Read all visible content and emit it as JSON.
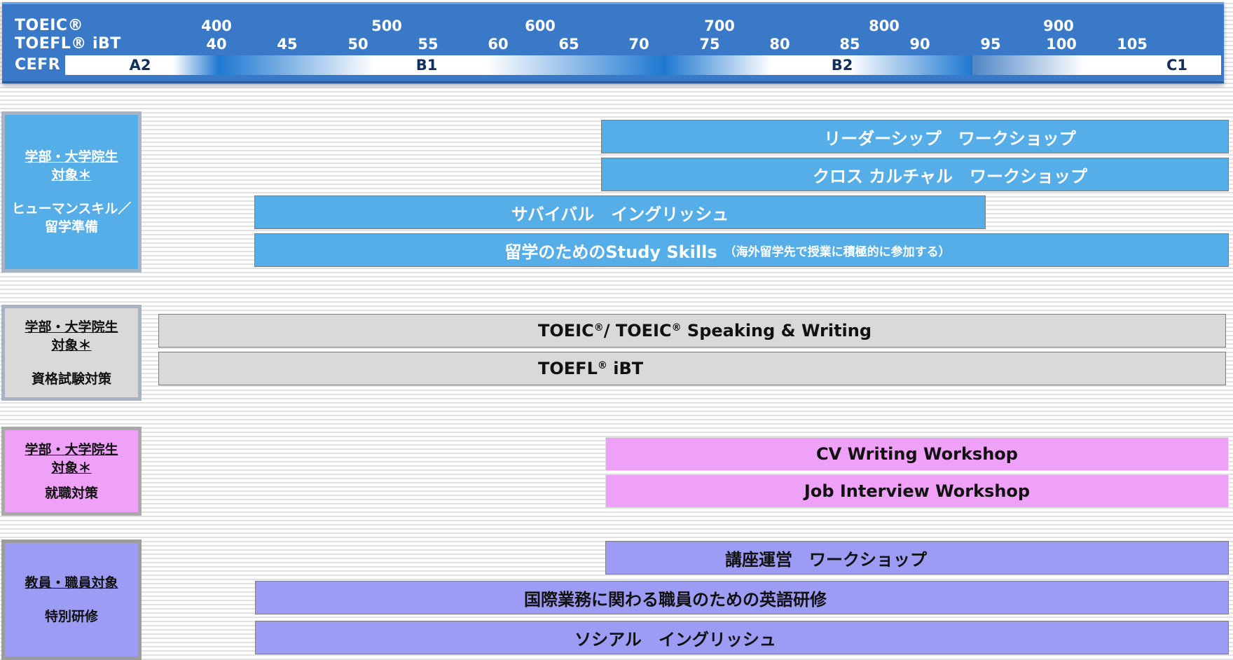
{
  "scales": {
    "toeic_label": "TOEIC®",
    "toeic_ticks": [
      "400",
      "500",
      "600",
      "700",
      "800",
      "900"
    ],
    "toefl_label": "TOEFL® iBT",
    "toefl_ticks": [
      "40",
      "45",
      "50",
      "55",
      "60",
      "65",
      "70",
      "75",
      "80",
      "85",
      "90",
      "95",
      "100",
      "105"
    ],
    "cefr_label": "CEFR",
    "cefr_levels": [
      "A2",
      "B1",
      "B2",
      "C1"
    ]
  },
  "categories": [
    {
      "audience_line1": "学部・大学院生",
      "audience_line2": "対象＊",
      "topic_line1": "ヒューマンスキル／",
      "topic_line2": "留学準備",
      "color": "#55aee8"
    },
    {
      "audience_line1": "学部・大学院生",
      "audience_line2": "対象＊",
      "topic_line1": "資格試験対策",
      "color": "#d9d9d9"
    },
    {
      "audience_line1": "学部・大学院生",
      "audience_line2": "対象＊",
      "topic_line1": "就職対策",
      "color": "#efa0f7"
    },
    {
      "audience_line1": "教員・職員対象",
      "topic_line1": "特別研修",
      "color": "#9c9cf4"
    }
  ],
  "programs": {
    "leadership": "リーダーシップ　ワークショップ",
    "cross_cultural": "クロス カルチャル　ワークショップ",
    "survival": "サバイバル　イングリッシュ",
    "study_skills": "留学のためのStudy Skills",
    "study_skills_note": "（海外留学先で授業に積極的に参加する）",
    "toeic_sw_pre": "TOEIC",
    "toeic_sw_mid": "/ TOEIC",
    "toeic_sw_post": " Speaking & Writing",
    "toefl_pre": "TOEFL",
    "toefl_post": " iBT",
    "reg": "®",
    "cv": "CV Writing Workshop",
    "interview": "Job Interview Workshop",
    "course_mgmt": "講座運営　ワークショップ",
    "intl_staff": "国際業務に関わる職員のための英語研修",
    "social": "ソシアル　イングリッシュ"
  }
}
